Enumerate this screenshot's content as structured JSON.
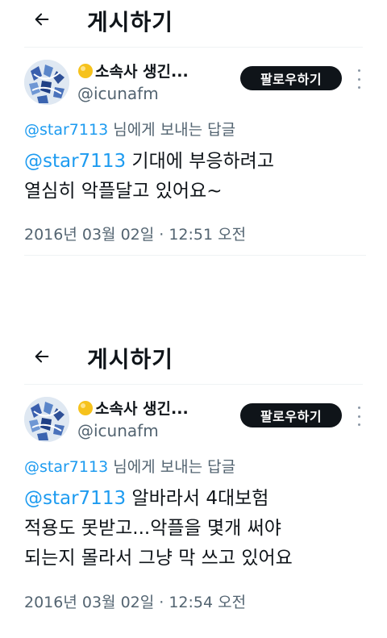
{
  "colors": {
    "link": "#1d9bf0",
    "text": "#0f1419",
    "muted": "#536471",
    "follow_bg": "#0f1419",
    "follow_text": "#ffffff"
  },
  "posts": [
    {
      "header": {
        "title": "게시하기",
        "back_icon": "arrow-left-icon"
      },
      "author": {
        "name": "소속사 생긴...",
        "handle": "@icunafm",
        "badge_icon": "sun-emoji-icon"
      },
      "follow_label": "팔로우하기",
      "reply": {
        "mention": "@star7113",
        "suffix": " 님에게 보내는 답글"
      },
      "text": {
        "mention": "@star7113",
        "line1_rest": " 기대에 부응하려고",
        "line2": "열심히 악플달고 있어요~",
        "line3": ""
      },
      "timestamp": "2016년 03월 02일 · 12:51 오전"
    },
    {
      "header": {
        "title": "게시하기",
        "back_icon": "arrow-left-icon"
      },
      "author": {
        "name": "소속사 생긴...",
        "handle": "@icunafm",
        "badge_icon": "sun-emoji-icon"
      },
      "follow_label": "팔로우하기",
      "reply": {
        "mention": "@star7113",
        "suffix": " 님에게 보내는 답글"
      },
      "text": {
        "mention": "@star7113",
        "line1_rest": " 알바라서 4대보험",
        "line2": "적용도 못받고...악플을 몇개 써야",
        "line3": "되는지 몰라서 그냥 막 쓰고 있어요"
      },
      "timestamp": "2016년 03월 02일 · 12:54 오전"
    }
  ]
}
